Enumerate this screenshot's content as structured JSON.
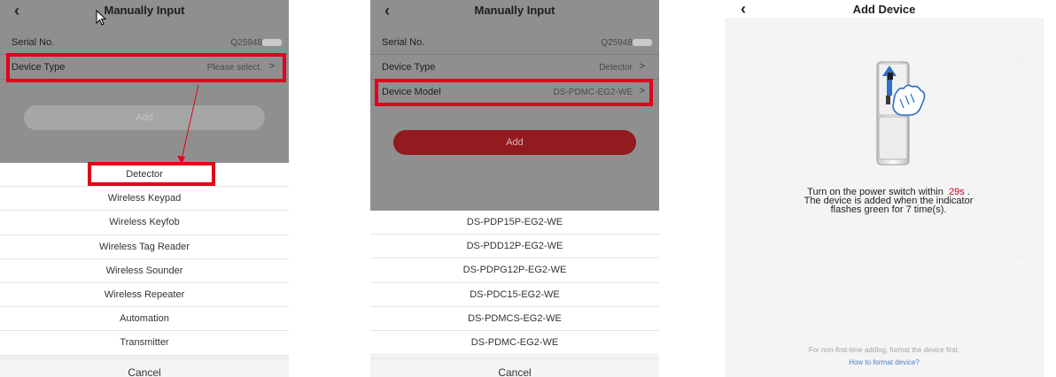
{
  "screen1": {
    "title": "Manually Input",
    "back_icon": "chevron-left-icon",
    "serial_label": "Serial No.",
    "serial_value": "Q25948",
    "device_type_label": "Device Type",
    "device_type_value": "Please select.",
    "chevron": ">",
    "add_label": "Add",
    "options": [
      "Detector",
      "Wireless Keypad",
      "Wireless Keyfob",
      "Wireless Tag Reader",
      "Wireless Sounder",
      "Wireless Repeater",
      "Automation",
      "Transmitter"
    ],
    "cancel_label": "Cancel"
  },
  "screen2": {
    "title": "Manually Input",
    "serial_label": "Serial No.",
    "serial_value": "Q25948",
    "device_type_label": "Device Type",
    "device_type_value": "Detector",
    "device_model_label": "Device Model",
    "device_model_value": "DS-PDMC-EG2-WE",
    "chevron": ">",
    "add_label": "Add",
    "options": [
      "DS-PDP15P-EG2-WE",
      "DS-PDD12P-EG2-WE",
      "DS-PDPG12P-EG2-WE",
      "DS-PDC15-EG2-WE",
      "DS-PDMCS-EG2-WE",
      "DS-PDMC-EG2-WE"
    ],
    "cancel_label": "Cancel"
  },
  "screen3": {
    "title": "Add Device",
    "instruction_1a": "Turn on the power switch within",
    "countdown": "29s",
    "instruction_1b": ".",
    "instruction_2": "The device is added when the indicator",
    "instruction_3": "flashes green for 7 time(s).",
    "note": "For non-first-time adding, format the device first.",
    "link": "How to format device?"
  },
  "colors": {
    "highlight": "#e2001a",
    "add_active": "#931a1f",
    "countdown": "#d0021b",
    "link": "#4f7ec9"
  }
}
